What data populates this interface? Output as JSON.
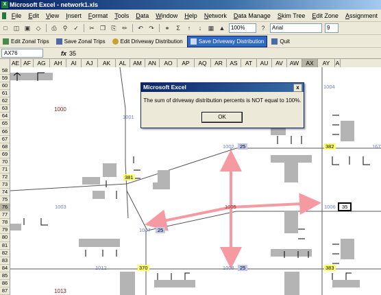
{
  "window": {
    "title": "Microsoft Excel - network1.xls"
  },
  "menu": [
    "File",
    "Edit",
    "View",
    "Insert",
    "Format",
    "Tools",
    "Data",
    "Window",
    "Help",
    "Network",
    "Data Manage",
    "Skim Tree",
    "Edit Zone",
    "Assignment"
  ],
  "toolbar": {
    "zoom": "100%",
    "font": "Arial",
    "font_size": "9"
  },
  "custom_toolbar": {
    "buttons": [
      "Edit Zonal Trips",
      "Save Zonal Trips",
      "Edit Driveway Distribution",
      "Save Driveway Distribution",
      "Quit"
    ]
  },
  "formula_bar": {
    "name_box": "AX76",
    "fx": "fx",
    "value": "35"
  },
  "columns": [
    "AE",
    "AF",
    "AG",
    "AH",
    "AI",
    "AJ",
    "AK",
    "AL",
    "AM",
    "AN",
    "AO",
    "AP",
    "AQ",
    "AR",
    "AS",
    "AT",
    "AU",
    "AV",
    "AW",
    "AX",
    "AY",
    "A"
  ],
  "selected_column": "AX",
  "rows": [
    "58",
    "59",
    "60",
    "61",
    "62",
    "63",
    "64",
    "65",
    "66",
    "67",
    "68",
    "69",
    "70",
    "71",
    "72",
    "73",
    "74",
    "75",
    "76",
    "77",
    "78",
    "79",
    "80",
    "81",
    "82",
    "83",
    "84",
    "85",
    "86",
    "87"
  ],
  "selected_row": "76",
  "diagram": {
    "zone_labels": [
      "1000",
      "1013"
    ],
    "node_labels": [
      "1001",
      "1004",
      "1002",
      "1003",
      "1006",
      "1007",
      "1008",
      "1012",
      "167"
    ],
    "highlight_labels": [
      "382",
      "381",
      "370",
      "383"
    ],
    "value_labels": [
      "25",
      "25",
      "25",
      "35"
    ],
    "center_label": "1005"
  },
  "dialog": {
    "title": "Microsoft Excel",
    "message": "The sum of driveway distribution percents is NOT equal to 100%.",
    "ok_label": "OK",
    "close_label": "x"
  },
  "colors": {
    "arrow": "#f49aa0",
    "road": "#555555",
    "block": "#b4b4b4",
    "highlight": "#ffff66",
    "cell_value": "#c0c8ee"
  }
}
